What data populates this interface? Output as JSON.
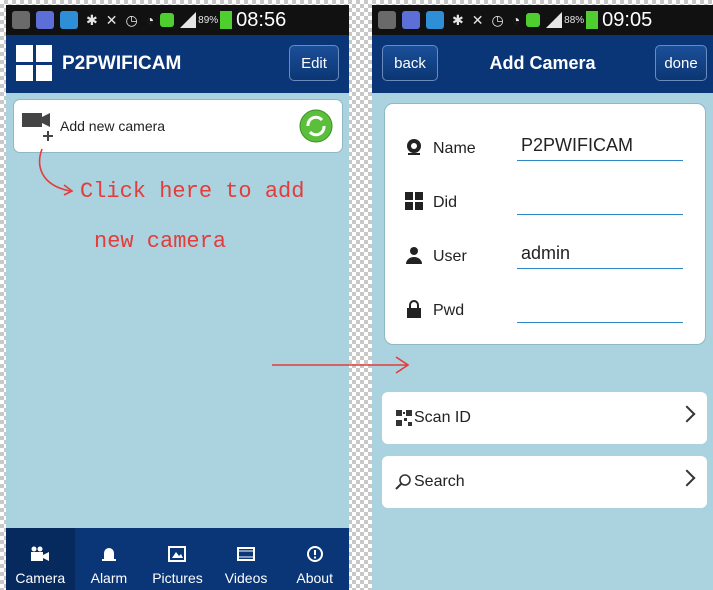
{
  "left": {
    "status": {
      "time": "08:56",
      "battery": "89%"
    },
    "header": {
      "title": "P2PWIFICAM",
      "edit_label": "Edit"
    },
    "add_camera": {
      "label": "Add new camera"
    },
    "annotation": {
      "line1": "Click here to add",
      "line2": "new camera"
    },
    "tabs": [
      {
        "label": "Camera",
        "icon": "camera-icon"
      },
      {
        "label": "Alarm",
        "icon": "bell-icon"
      },
      {
        "label": "Pictures",
        "icon": "picture-icon"
      },
      {
        "label": "Videos",
        "icon": "film-icon"
      },
      {
        "label": "About",
        "icon": "info-icon"
      }
    ]
  },
  "right": {
    "status": {
      "time": "09:05",
      "battery": "88%"
    },
    "header": {
      "back_label": "back",
      "title": "Add Camera",
      "done_label": "done"
    },
    "form": {
      "name_label": "Name",
      "name_value": "P2PWIFICAM",
      "did_label": "Did",
      "did_value": "",
      "user_label": "User",
      "user_value": "admin",
      "pwd_label": "Pwd",
      "pwd_value": ""
    },
    "scan_label": "Scan ID",
    "search_label": "Search"
  },
  "colors": {
    "nav": "#0a3677",
    "bg": "#aad3df",
    "annotation": "#e43b3b"
  }
}
